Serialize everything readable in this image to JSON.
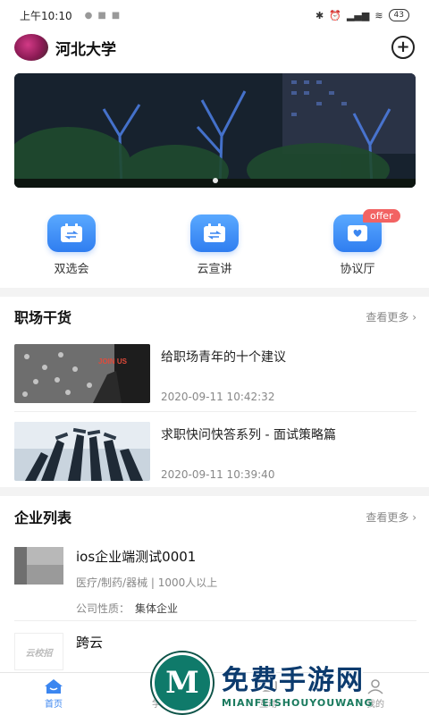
{
  "status_bar": {
    "time": "上午10:10",
    "battery": "43"
  },
  "header": {
    "school_name": "河北大学"
  },
  "quick_entries": [
    {
      "label": "双选会"
    },
    {
      "label": "云宣讲"
    },
    {
      "label": "协议厅",
      "badge": "offer"
    }
  ],
  "career": {
    "title": "职场干货",
    "more": "查看更多",
    "articles": [
      {
        "title": "给职场青年的十个建议",
        "time": "2020-09-11 10:42:32",
        "thumb_text": "JOIN US"
      },
      {
        "title": "求职快问快答系列 - 面试策略篇",
        "time": "2020-09-11 10:39:40"
      }
    ]
  },
  "companies": {
    "title": "企业列表",
    "more": "查看更多",
    "nature_label": "公司性质：",
    "items": [
      {
        "name": "ios企业端测试0001",
        "meta": "医疗/制药/器械 | 1000人以上",
        "nature": "集体企业"
      },
      {
        "name": "跨云",
        "logo_text": "云校招"
      }
    ]
  },
  "tabbar": [
    {
      "label": "首页",
      "icon": "home-icon",
      "active": true
    },
    {
      "label": "学生",
      "icon": "graduation-cap-icon"
    },
    {
      "label": "互动",
      "icon": "chat-icon"
    },
    {
      "label": "我的",
      "icon": "user-icon"
    }
  ],
  "watermark": {
    "cn": "免费手游网",
    "en": "MIANFEISHOUYOUWANG",
    "logo": "M"
  },
  "colors": {
    "accent": "#3b86f0",
    "badge": "#f26363"
  }
}
